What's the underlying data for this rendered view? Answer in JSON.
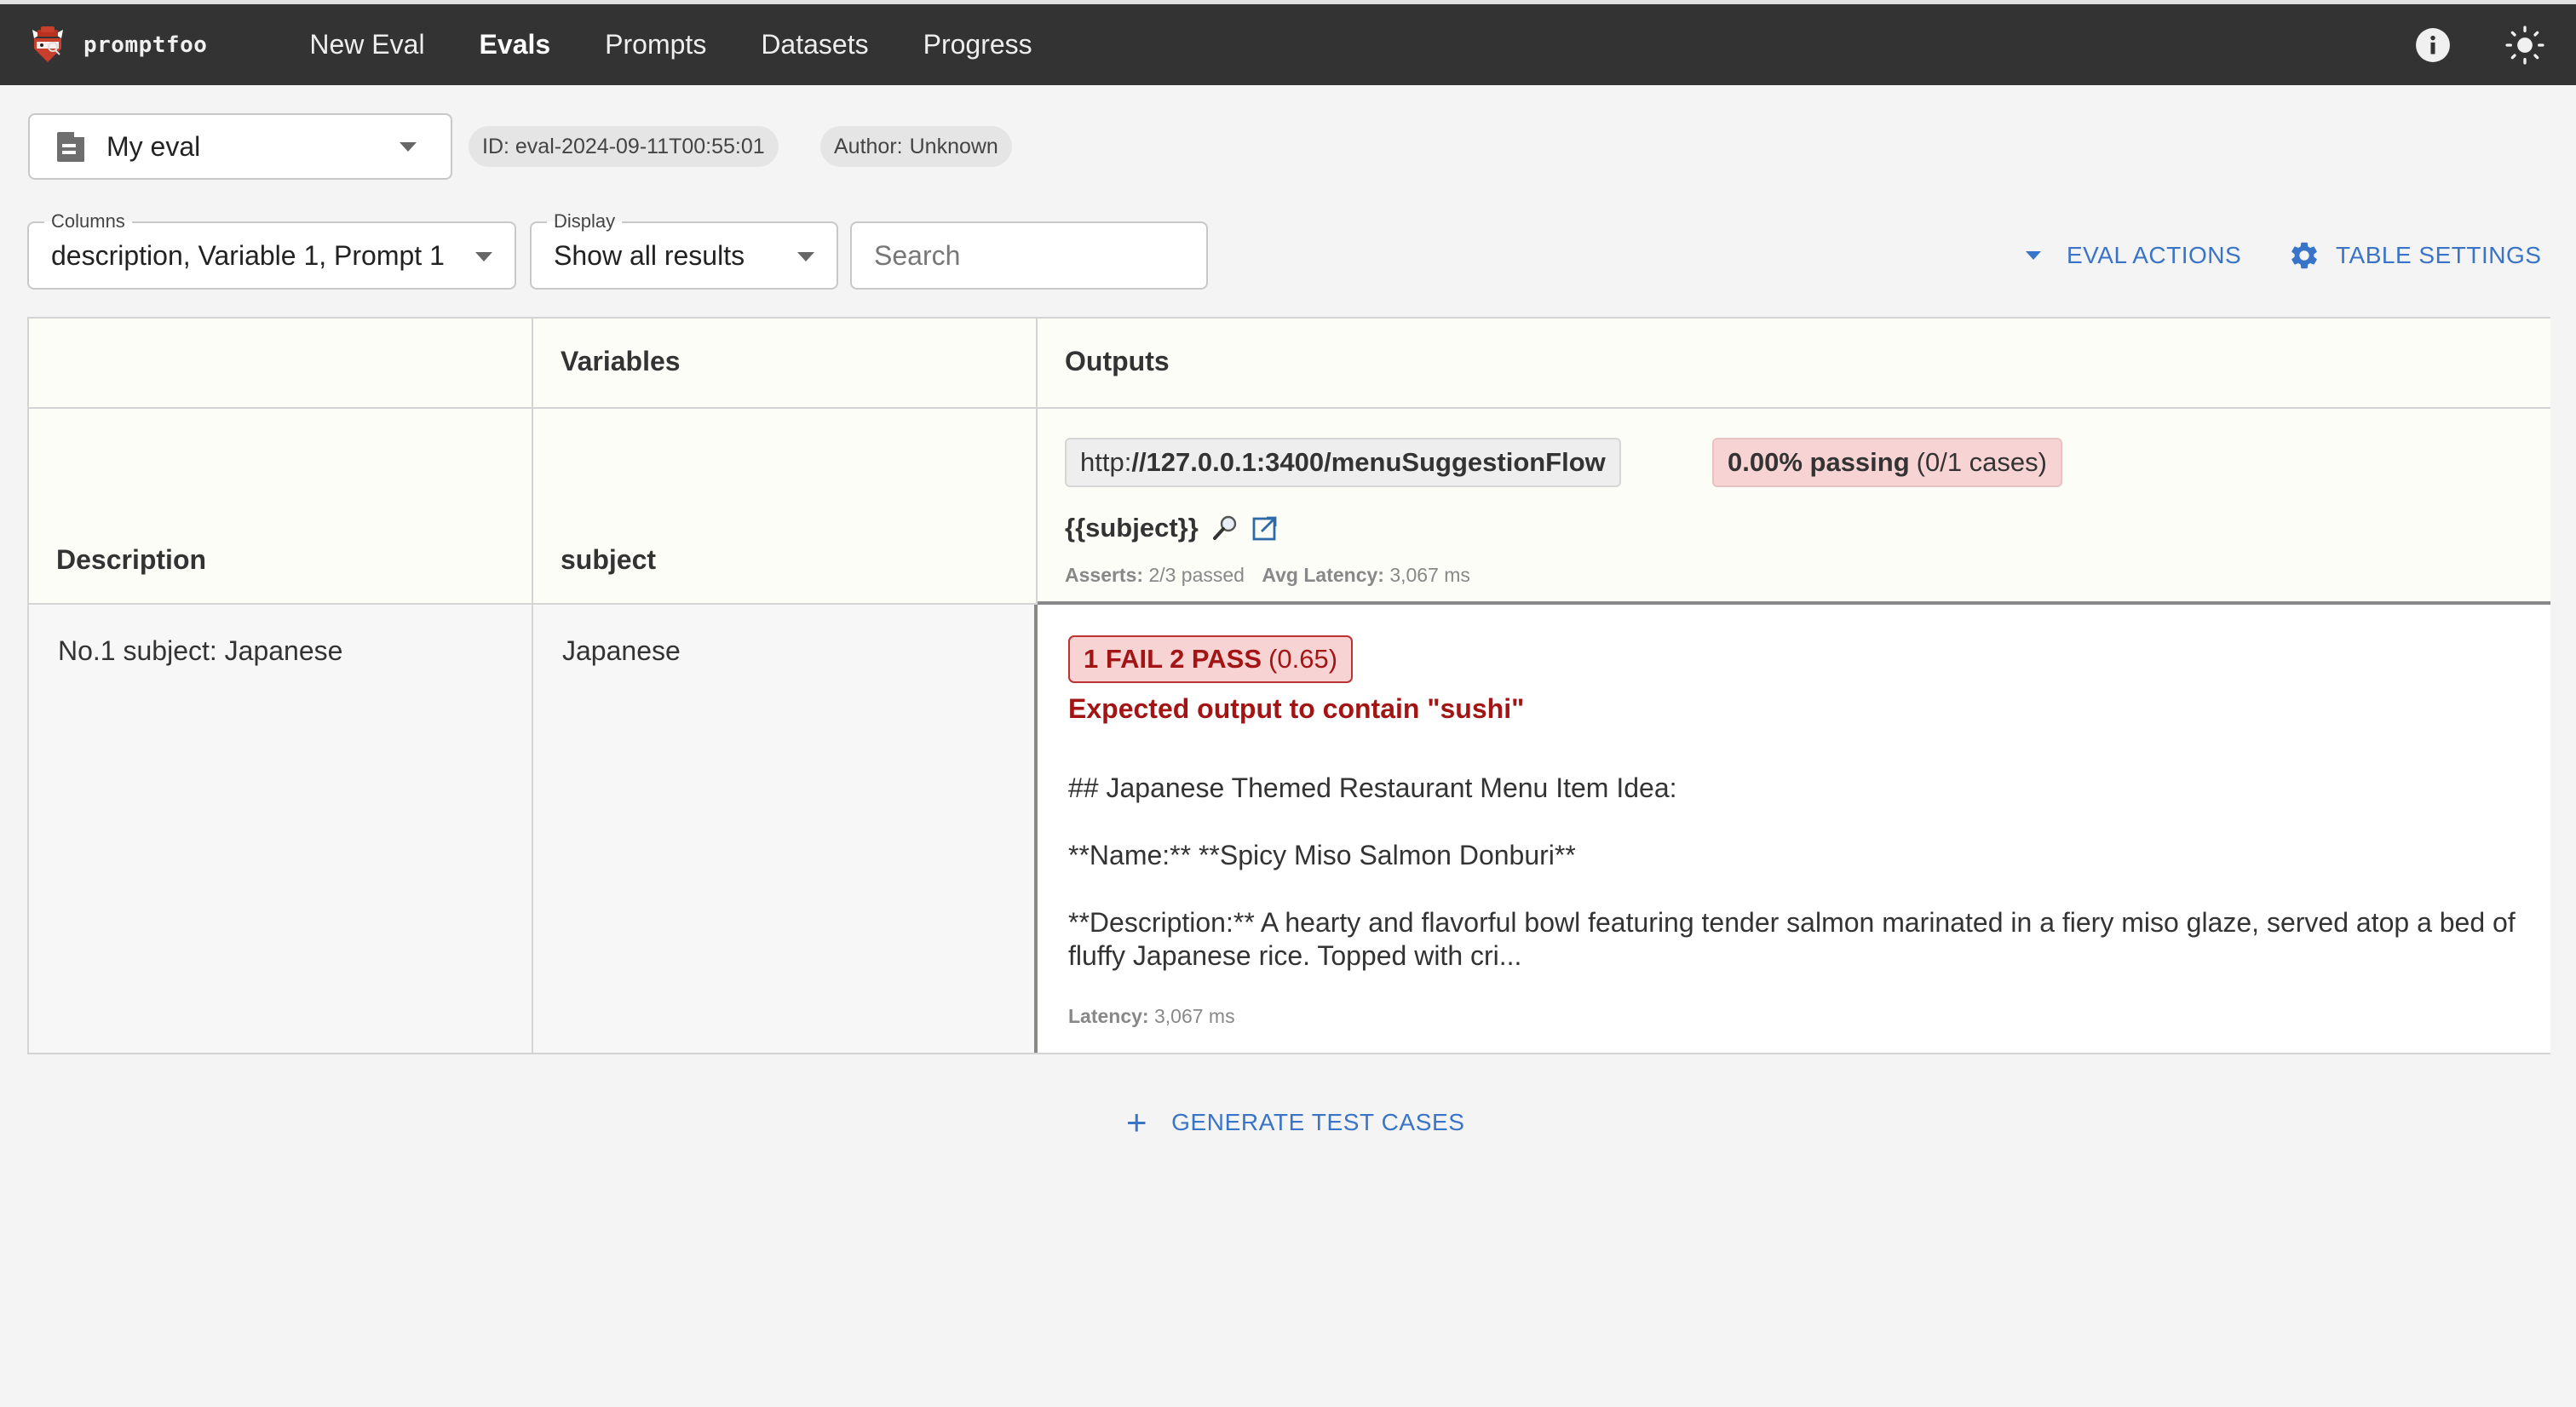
{
  "app": {
    "name": "promptfoo"
  },
  "nav": {
    "items": [
      {
        "label": "New Eval",
        "active": false
      },
      {
        "label": "Evals",
        "active": true
      },
      {
        "label": "Prompts",
        "active": false
      },
      {
        "label": "Datasets",
        "active": false
      },
      {
        "label": "Progress",
        "active": false
      }
    ],
    "icons": [
      "info-icon",
      "theme-toggle-sun-icon"
    ]
  },
  "eval_selector": {
    "icon": "document-icon",
    "value": "My eval"
  },
  "chips": {
    "id": "ID: eval-2024-09-11T00:55:01",
    "author_label": "Author:",
    "author_value": "Unknown"
  },
  "filters": {
    "columns": {
      "legend": "Columns",
      "value": "description, Variable 1, Prompt 1"
    },
    "display": {
      "legend": "Display",
      "value": "Show all results"
    },
    "search": {
      "placeholder": "Search",
      "value": ""
    }
  },
  "actions": {
    "eval_actions": "EVAL ACTIONS",
    "table_settings": "TABLE SETTINGS"
  },
  "table": {
    "group_headers": {
      "description": "",
      "variables": "Variables",
      "outputs": "Outputs"
    },
    "column_headers": {
      "description": "Description",
      "variable": "subject"
    },
    "output_header": {
      "provider_prefix": "http:",
      "provider_main": "//127.0.0.1:3400/menuSuggestionFlow",
      "passing_pct": "0.00% passing",
      "passing_cases": "(0/1 cases)",
      "prompt": "{{subject}}",
      "asserts_label": "Asserts:",
      "asserts_value": "2/3 passed",
      "avg_latency_label": "Avg Latency:",
      "avg_latency_value": "3,067 ms",
      "status_color": "#f8d3d3"
    },
    "rows": [
      {
        "description": "No.1 subject: Japanese",
        "subject": "Japanese",
        "output": {
          "badge_main": "1 FAIL 2 PASS",
          "badge_score": "(0.65)",
          "fail_reason": "Expected output to contain \"sushi\"",
          "text_lines": [
            "## Japanese Themed Restaurant Menu Item Idea:",
            "**Name:** **Spicy Miso Salmon Donburi**",
            "**Description:**  A hearty and flavorful bowl featuring tender salmon marinated in a fiery miso glaze, served atop a bed of fluffy Japanese rice. Topped with cri..."
          ],
          "latency_label": "Latency:",
          "latency_value": "3,067 ms",
          "fail_color": "#a31515"
        }
      }
    ]
  },
  "generate_button": {
    "label": "GENERATE TEST CASES"
  },
  "colors": {
    "nav_bg": "#333333",
    "accent": "#3a74c8",
    "page_bg": "#f4f4f4",
    "header_bg": "#fdfdf8",
    "fail": "#a31515"
  }
}
